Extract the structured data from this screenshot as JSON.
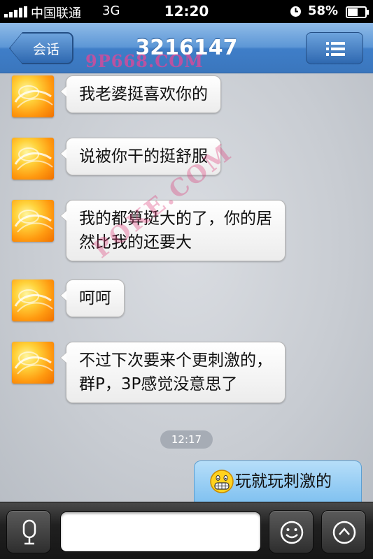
{
  "status_bar": {
    "carrier": "中国联通",
    "network": "3G",
    "time": "12:20",
    "battery_percent": "58%"
  },
  "nav": {
    "back_label": "会话",
    "title": "3216147",
    "watermark_top": "9P668.COM",
    "watermark_diagonal": "POKE.COM",
    "menu_icon": "list-icon"
  },
  "messages": [
    {
      "direction": "incoming",
      "lines": [
        "我老婆挺喜欢你的"
      ]
    },
    {
      "direction": "incoming",
      "lines": [
        "说被你干的挺舒服"
      ]
    },
    {
      "direction": "incoming",
      "lines": [
        "我的都算挺大的了，你的居",
        "然比我的还要大"
      ]
    },
    {
      "direction": "incoming",
      "lines": [
        "呵呵"
      ]
    },
    {
      "direction": "incoming",
      "lines": [
        "不过下次要来个更刺激的，",
        "群P，3P感觉没意思了"
      ]
    },
    {
      "direction": "timestamp",
      "text": "12:17"
    },
    {
      "direction": "outgoing",
      "emoji": "grin-emoji",
      "text": "玩就玩刺激的"
    }
  ],
  "input_bar": {
    "voice_icon": "microphone-icon",
    "text_value": "",
    "emoji_icon": "smiley-icon",
    "more_icon": "chevron-up-icon"
  },
  "colors": {
    "nav_blue": "#4a86cf",
    "outgoing_bubble": "#9fd1f5",
    "incoming_bubble": "#ffffff",
    "timestamp_pill": "#a6acb5",
    "watermark": "#e64696"
  }
}
